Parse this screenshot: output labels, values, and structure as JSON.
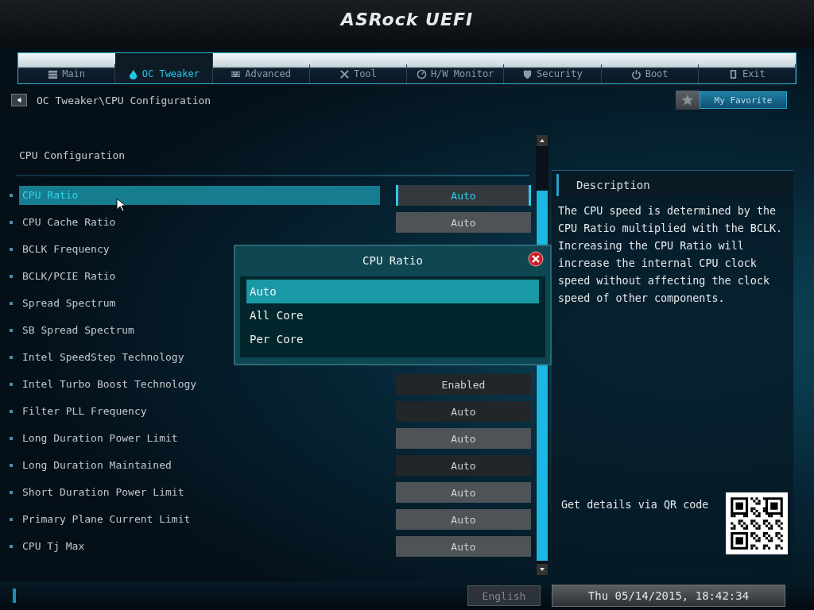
{
  "title": "ASRock UEFI",
  "tabs": [
    {
      "label": "Main",
      "selected": false
    },
    {
      "label": "OC Tweaker",
      "selected": true
    },
    {
      "label": "Advanced",
      "selected": false
    },
    {
      "label": "Tool",
      "selected": false
    },
    {
      "label": "H/W Monitor",
      "selected": false
    },
    {
      "label": "Security",
      "selected": false
    },
    {
      "label": "Boot",
      "selected": false
    },
    {
      "label": "Exit",
      "selected": false
    }
  ],
  "breadcrumb": "OC Tweaker\\CPU Configuration",
  "favorite": "My Favorite",
  "section_title": "CPU Configuration",
  "settings": [
    {
      "label": "CPU Ratio",
      "value": "Auto",
      "kind": "option",
      "selected": true
    },
    {
      "label": "CPU Cache Ratio",
      "value": "Auto",
      "kind": "field",
      "selected": false
    },
    {
      "label": "BCLK Frequency",
      "selected": false
    },
    {
      "label": "BCLK/PCIE Ratio",
      "selected": false
    },
    {
      "label": "Spread Spectrum",
      "selected": false
    },
    {
      "label": "SB Spread Spectrum",
      "selected": false
    },
    {
      "label": "Intel SpeedStep Technology",
      "selected": false
    },
    {
      "label": "Intel Turbo Boost Technology",
      "value": "Enabled",
      "kind": "option",
      "selected": false
    },
    {
      "label": "Filter PLL Frequency",
      "value": "Auto",
      "kind": "option",
      "selected": false
    },
    {
      "label": "Long Duration Power Limit",
      "value": "Auto",
      "kind": "field",
      "selected": false
    },
    {
      "label": "Long Duration Maintained",
      "value": "Auto",
      "kind": "option",
      "selected": false
    },
    {
      "label": "Short Duration Power Limit",
      "value": "Auto",
      "kind": "field",
      "selected": false
    },
    {
      "label": "Primary Plane Current Limit",
      "value": "Auto",
      "kind": "field",
      "selected": false
    },
    {
      "label": "CPU Tj Max",
      "value": "Auto",
      "kind": "field",
      "selected": false
    }
  ],
  "description": {
    "title": "Description",
    "text": "The CPU speed is determined by the CPU Ratio multiplied with the BCLK. Increasing the CPU Ratio will increase the internal CPU clock speed without affecting the clock speed of other components.",
    "qr_caption": "Get details via QR code"
  },
  "popup": {
    "title": "CPU Ratio",
    "options": [
      {
        "label": "Auto",
        "selected": true
      },
      {
        "label": "All Core",
        "selected": false
      },
      {
        "label": "Per Core",
        "selected": false
      }
    ]
  },
  "language": "English",
  "datetime": "Thu 05/14/2015, 18:42:34"
}
